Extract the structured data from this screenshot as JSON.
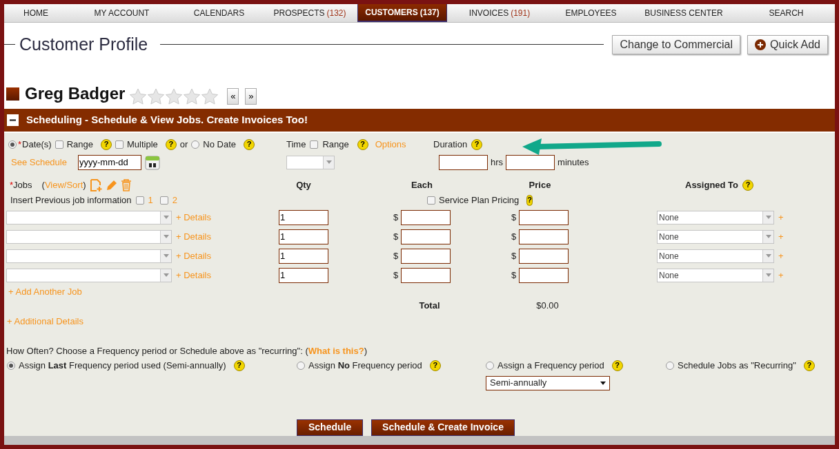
{
  "nav": [
    {
      "label": "HOME",
      "selected": false
    },
    {
      "label": "MY ACCOUNT",
      "selected": false
    },
    {
      "label": "CALENDARS",
      "selected": false
    },
    {
      "label": "PROSPECTS",
      "count": "(132)",
      "selected": false
    },
    {
      "label": "CUSTOMERS",
      "count": "(137)",
      "selected": true
    },
    {
      "label": "INVOICES",
      "count": "(191)",
      "selected": false
    },
    {
      "label": "EMPLOYEES",
      "selected": false
    },
    {
      "label": "BUSINESS CENTER",
      "selected": false
    },
    {
      "label": "SEARCH",
      "selected": false
    }
  ],
  "page_title": "Customer Profile",
  "header_buttons": [
    {
      "kind": "plain",
      "label": "Change to Commercial"
    },
    {
      "kind": "add",
      "label": "Quick Add"
    }
  ],
  "customer": {
    "name": "Greg Badger",
    "stars": 0,
    "prev": "«",
    "next": "»"
  },
  "section": {
    "title": "Scheduling - Schedule & View Jobs. Create Invoices Too!",
    "expanded": true
  },
  "date": {
    "options": [
      {
        "kind": "radio",
        "label": "Date(s)",
        "required_mark": "*",
        "checked": true
      },
      {
        "kind": "checkbox",
        "label": "Range",
        "checked": false,
        "help": "?"
      },
      {
        "kind": "checkbox",
        "label": "Multiple",
        "checked": false,
        "help": "?"
      },
      {
        "kind": "text",
        "label": "or"
      },
      {
        "kind": "radio",
        "label": "No Date",
        "checked": false,
        "help": "?"
      }
    ],
    "link": "See Schedule",
    "value": "yyyy-mm-dd"
  },
  "time": {
    "label": "Time",
    "range_label": "Range",
    "range_checked": false,
    "help": "?",
    "link": "Options"
  },
  "duration": {
    "label": "Duration",
    "help": "?",
    "hours_unit": "hrs",
    "minutes_unit": "minutes"
  },
  "jobs": {
    "required_mark": "*",
    "label": "Jobs",
    "link_open": "(",
    "link": "View/Sort",
    "link_close": ")",
    "insert_label": "Insert Previous job information",
    "insert_options": [
      {
        "label": "1",
        "checked": false
      },
      {
        "label": "2",
        "checked": false
      }
    ],
    "columns": [
      "Qty",
      "Each",
      "Price",
      "Assigned To"
    ],
    "assigned_help": "?",
    "service_plan": {
      "label": "Service Plan Pricing",
      "checked": false,
      "help": "?"
    },
    "rows": [
      {
        "details": "+ Details",
        "qty": "1",
        "each_symbol": "$",
        "price_symbol": "$",
        "assigned": "None",
        "assign_add": "+"
      },
      {
        "details": "+ Details",
        "qty": "1",
        "each_symbol": "$",
        "price_symbol": "$",
        "assigned": "None",
        "assign_add": "+"
      },
      {
        "details": "+ Details",
        "qty": "1",
        "each_symbol": "$",
        "price_symbol": "$",
        "assigned": "None",
        "assign_add": "+"
      },
      {
        "details": "+ Details",
        "qty": "1",
        "each_symbol": "$",
        "price_symbol": "$",
        "assigned": "None",
        "assign_add": "+"
      }
    ],
    "add_link": "+ Add Another Job",
    "total_label": "Total",
    "total": "$0.00",
    "additional_link": "+ Additional Details"
  },
  "frequency": {
    "prompt": "How Often? Choose a Frequency period or Schedule above as \"recurring\": (",
    "link": "What is this?",
    "prompt_end": ")",
    "options": [
      {
        "label": "Assign **Last** Frequency period used (Semi-annually)",
        "selected": true,
        "help": "?"
      },
      {
        "label": "Assign **No** Frequency period",
        "selected": false,
        "help": "?"
      },
      {
        "label": "Assign a Frequency period",
        "selected": false,
        "help": "?",
        "select": "Semi-annually"
      },
      {
        "label": "Schedule Jobs as \"Recurring\"",
        "selected": false,
        "help": "?"
      }
    ]
  },
  "actions": [
    {
      "label": "Schedule"
    },
    {
      "label": "Schedule & Create Invoice"
    }
  ]
}
